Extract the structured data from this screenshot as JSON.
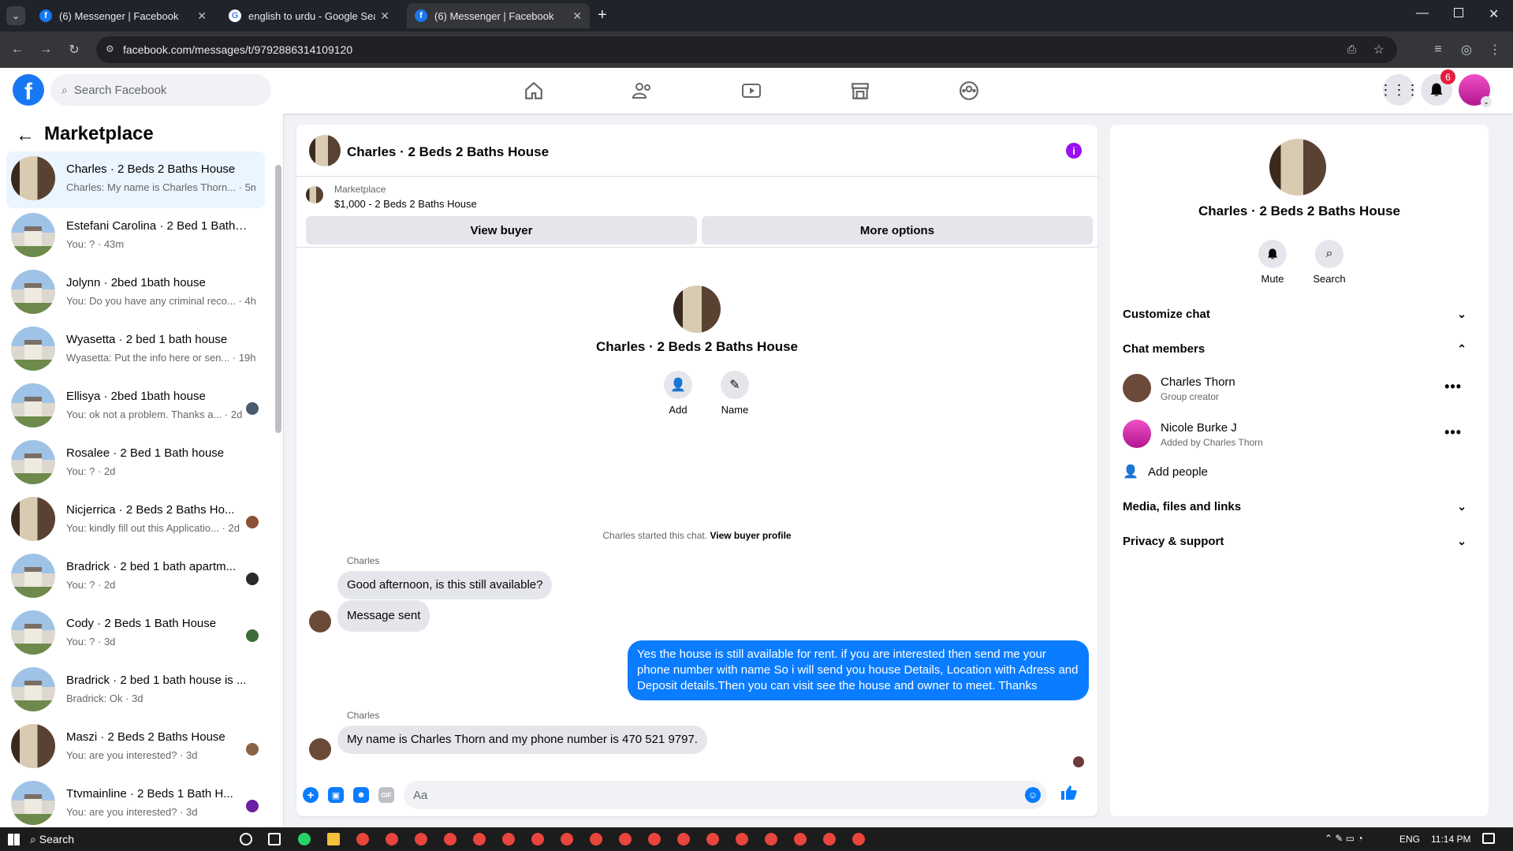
{
  "browser": {
    "tabs": [
      {
        "title": "(6) Messenger | Facebook",
        "active": false
      },
      {
        "title": "english to urdu - Google Search",
        "active": false
      },
      {
        "title": "(6) Messenger | Facebook",
        "active": true
      }
    ],
    "url": "facebook.com/messages/t/9792886314109120"
  },
  "fb": {
    "search_placeholder": "Search Facebook",
    "notification_count": "6"
  },
  "left": {
    "title": "Marketplace",
    "conversations": [
      {
        "title": "Charles · 2 Beds 2 Baths House",
        "sub": "Charles: My name is Charles Thorn... · 5m",
        "selected": true
      },
      {
        "title": "Estefani Carolina · 2 Bed 1 Bath ...",
        "sub": "You: ? · 43m"
      },
      {
        "title": "Jolynn · 2bed 1bath house",
        "sub": "You: Do you have any criminal reco... · 4h"
      },
      {
        "title": "Wyasetta · 2 bed 1 bath house",
        "sub": "Wyasetta: Put the info here or sen... · 19h"
      },
      {
        "title": "Ellisya · 2bed 1bath house",
        "sub": "You: ok not a problem. Thanks a... · 2d"
      },
      {
        "title": "Rosalee · 2 Bed 1 Bath house",
        "sub": "You: ? · 2d"
      },
      {
        "title": "Nicjerrica · 2 Beds 2 Baths Ho...",
        "sub": "You: kindly fill out this Applicatio... · 2d"
      },
      {
        "title": "Bradrick · 2 bed 1 bath apartm...",
        "sub": "You: ? · 2d"
      },
      {
        "title": "Cody · 2 Beds 1 Bath House",
        "sub": "You: ? · 3d"
      },
      {
        "title": "Bradrick · 2 bed 1 bath house is ...",
        "sub": "Bradrick: Ok · 3d"
      },
      {
        "title": "Maszi · 2 Beds 2 Baths House",
        "sub": "You: are you interested? · 3d"
      },
      {
        "title": "Ttvmainline · 2 Beds 1 Bath H...",
        "sub": "You: are you interested? · 3d"
      }
    ]
  },
  "chat": {
    "title": "Charles · 2 Beds 2 Baths House",
    "marketplace_label": "Marketplace",
    "listing": "$1,000 - 2 Beds 2 Baths House",
    "view_buyer": "View buyer",
    "more_options": "More options",
    "intro_title": "Charles · 2 Beds 2 Baths House",
    "add_label": "Add",
    "name_label": "Name",
    "started_text": "Charles started this chat.",
    "view_buyer_profile": "View buyer profile",
    "messages": [
      {
        "sender": "Charles",
        "text": "Good afternoon, is this still available?"
      },
      {
        "text": "Message sent"
      },
      {
        "text": "Yes the house is still available for rent. if you are interested then send me your phone number with name So i will send you house Details, Location with Adress and Deposit details.Then you can visit see the house and owner to meet. Thanks"
      },
      {
        "sender": "Charles",
        "text": "My name is Charles Thorn and my phone number is 470 521 9797."
      }
    ],
    "composer_placeholder": "Aa"
  },
  "right": {
    "title": "Charles · 2 Beds 2 Baths House",
    "mute_label": "Mute",
    "search_label": "Search",
    "customize_chat": "Customize chat",
    "chat_members": "Chat members",
    "members": [
      {
        "name": "Charles Thorn",
        "sub": "Group creator"
      },
      {
        "name": "Nicole Burke J",
        "sub": "Added by Charles Thorn"
      }
    ],
    "add_people": "Add people",
    "media": "Media, files and links",
    "privacy": "Privacy & support"
  },
  "taskbar": {
    "search": "Search",
    "lang": "ENG",
    "time": "11:14 PM"
  },
  "colors": {
    "fb_blue": "#1877f2",
    "bubble_out": "#0a7cff",
    "info_purple": "#9b0ff0"
  }
}
